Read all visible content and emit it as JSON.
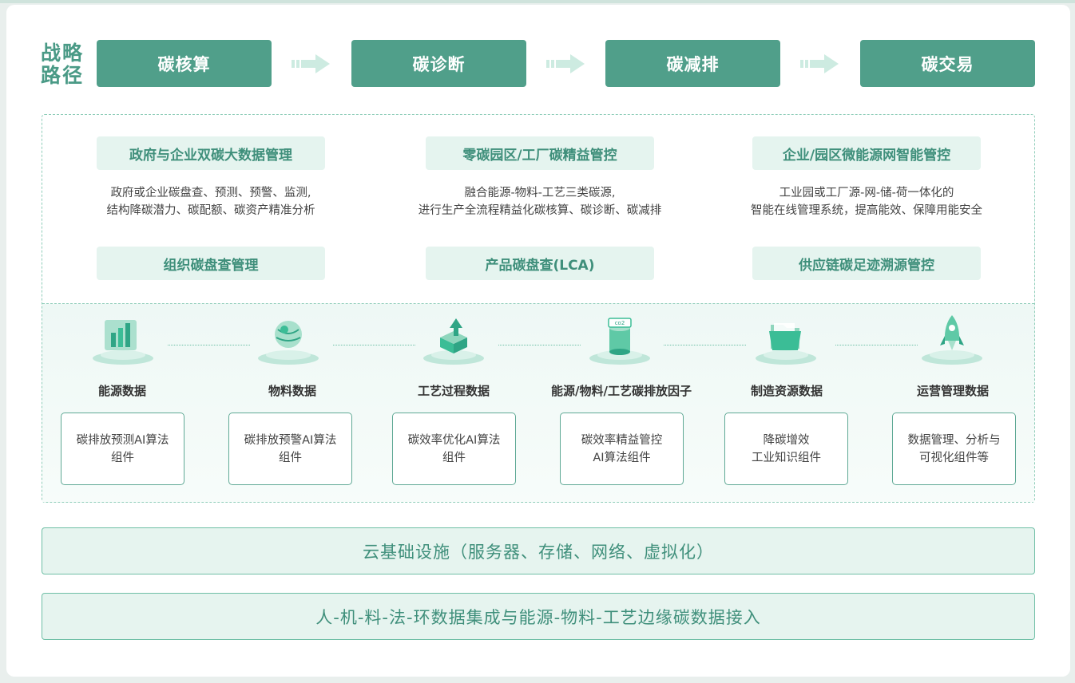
{
  "strategy": {
    "label_line1": "战略",
    "label_line2": "路径",
    "steps": [
      "碳核算",
      "碳诊断",
      "碳减排",
      "碳交易"
    ]
  },
  "solutions": [
    {
      "title": "政府与企业双碳大数据管理",
      "desc1": "政府或企业碳盘查、预测、预警、监测,",
      "desc2": "结构降碳潜力、碳配额、碳资产精准分析"
    },
    {
      "title": "零碳园区/工厂碳精益管控",
      "desc1": "融合能源-物料-工艺三类碳源,",
      "desc2": "进行生产全流程精益化碳核算、碳诊断、碳减排"
    },
    {
      "title": "企业/园区微能源网智能管控",
      "desc1": "工业园或工厂源-网-储-荷一体化的",
      "desc2": "智能在线管理系统，提高能效、保障用能安全"
    }
  ],
  "products": [
    "组织碳盘查管理",
    "产品碳盘查(LCA)",
    "供应链碳足迹溯源管控"
  ],
  "data_sources": [
    {
      "label": "能源数据",
      "icon": "bar-chart-icon"
    },
    {
      "label": "物料数据",
      "icon": "globe-icon"
    },
    {
      "label": "工艺过程数据",
      "icon": "arrow-up-cube-icon"
    },
    {
      "label": "能源/物料/工艺碳排放因子",
      "icon": "co2-cylinder-icon"
    },
    {
      "label": "制造资源数据",
      "icon": "folder-icon"
    },
    {
      "label": "运营管理数据",
      "icon": "rocket-icon"
    }
  ],
  "components": [
    {
      "line1": "碳排放预测AI算法",
      "line2": "组件"
    },
    {
      "line1": "碳排放预警AI算法",
      "line2": "组件"
    },
    {
      "line1": "碳效率优化AI算法",
      "line2": "组件"
    },
    {
      "line1": "碳效率精益管控",
      "line2": "AI算法组件"
    },
    {
      "line1": "降碳增效",
      "line2": "工业知识组件"
    },
    {
      "line1": "数据管理、分析与",
      "line2": "可视化组件等"
    }
  ],
  "infrastructure": {
    "cloud": "云基础设施（服务器、存储、网络、虚拟化）",
    "edge": "人-机-料-法-环数据集成与能源-物料-工艺边缘碳数据接入"
  },
  "colors": {
    "primary": "#509f8a",
    "pill_bg": "#e5f4ef",
    "pill_text": "#3f8f7b",
    "border": "#5fa995"
  }
}
